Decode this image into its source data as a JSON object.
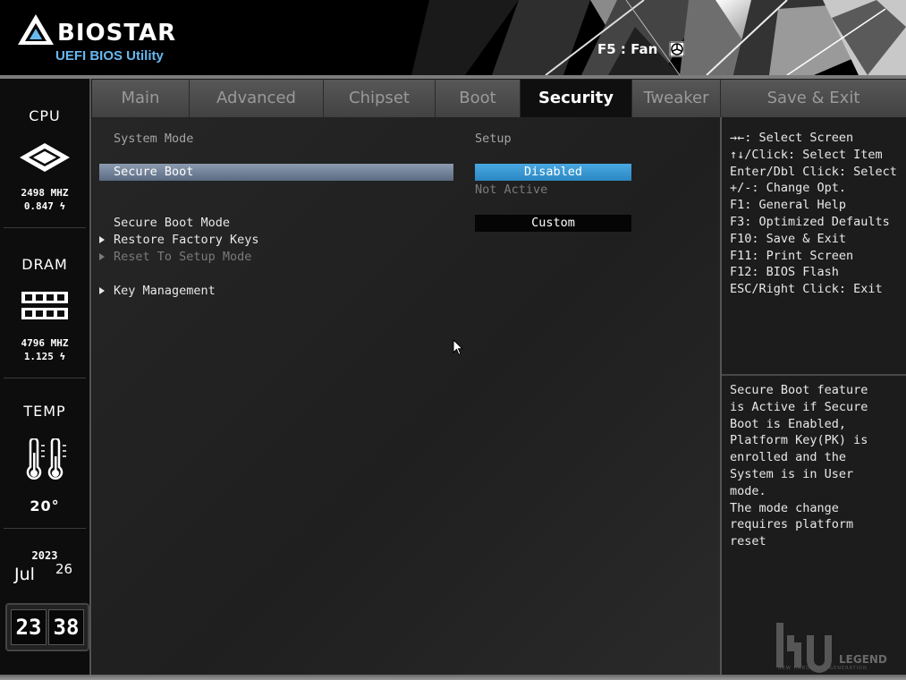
{
  "header": {
    "brand": "BIOSTAR",
    "subtitle": "UEFI BIOS Utility",
    "fan_hint": "F5 : Fan",
    "fan_icon": "fan-icon"
  },
  "sidebar": {
    "cpu": {
      "title": "CPU",
      "freq": "2498 MHZ",
      "volt": "0.847 ϟ",
      "icon": "cpu-chip-icon"
    },
    "dram": {
      "title": "DRAM",
      "freq": "4796 MHZ",
      "volt": "1.125 ϟ",
      "icon": "memory-module-icon"
    },
    "temp": {
      "title": "TEMP",
      "value": "20°",
      "icon": "thermometer-icon"
    },
    "date": {
      "year": "2023",
      "month": "Jul",
      "day": "26"
    },
    "clock": {
      "hour": "23",
      "minute": "38"
    }
  },
  "tabs": [
    {
      "label": "Main"
    },
    {
      "label": "Advanced"
    },
    {
      "label": "Chipset"
    },
    {
      "label": "Boot"
    },
    {
      "label": "Security",
      "active": true
    },
    {
      "label": "Tweaker"
    },
    {
      "label": "Save & Exit"
    }
  ],
  "security": {
    "system_mode_label": "System Mode",
    "system_mode_value": "Setup",
    "secure_boot_label": "Secure Boot",
    "secure_boot_value": "Disabled",
    "secure_boot_status": "Not Active",
    "secure_boot_mode_label": "Secure Boot Mode",
    "secure_boot_mode_value": "Custom",
    "restore_keys_label": "Restore Factory Keys",
    "reset_setup_label": "Reset To Setup Mode",
    "key_management_label": "Key Management"
  },
  "help": {
    "keys": [
      "→←: Select Screen",
      "↑↓/Click: Select Item",
      "Enter/Dbl Click: Select",
      "+/-: Change Opt.",
      "F1: General Help",
      "F3: Optimized Defaults",
      "F10: Save & Exit",
      "F11: Print Screen",
      "F12: BIOS Flash",
      "ESC/Right Click: Exit"
    ],
    "description": [
      "Secure Boot feature",
      "is Active if Secure",
      "Boot is Enabled,",
      "Platform Key(PK) is",
      "enrolled and the",
      "System is in User",
      "mode.",
      "The mode change",
      "requires platform",
      "reset"
    ]
  },
  "watermark": {
    "text": "LEGEND",
    "small": "NEW HARDWARE GENERATION"
  },
  "colors": {
    "accent": "#3399d6",
    "selected_row": "#7a8aa0"
  }
}
